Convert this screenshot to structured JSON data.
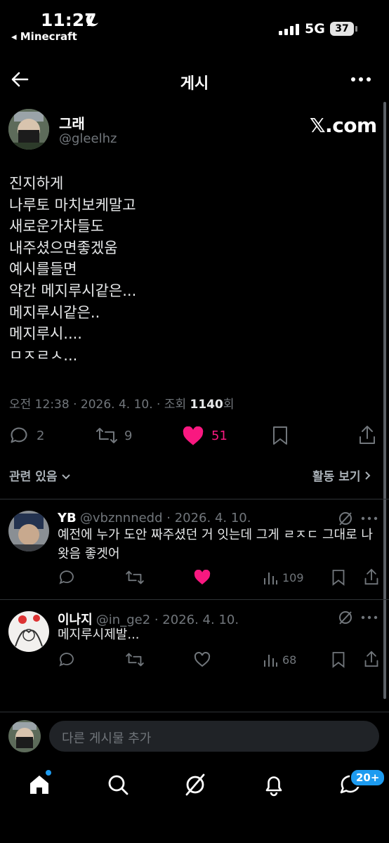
{
  "status_bar": {
    "time": "11:27",
    "back_app": "◂ Minecraft",
    "network": "5G",
    "battery": "37"
  },
  "header": {
    "title": "게시"
  },
  "post": {
    "author_name": "그래",
    "author_handle": "@gleelhz",
    "watermark": "𝕏.com",
    "lines": [
      "진지하게",
      "나루토 마치보케말고",
      "새로운가차들도",
      "내주셨으면좋겠움",
      "예시를들면",
      "약간 메지루시같은...",
      "메지루시같은..",
      "메지루시....",
      "ㅁㅈㄹㅅ..."
    ],
    "meta_prefix": "오전 12:38 · 2026. 4. 10. · 조회 ",
    "views": "1140",
    "meta_suffix": "회",
    "actions": {
      "replies": "2",
      "reposts": "9",
      "likes": "51"
    }
  },
  "related": {
    "left_label": "관련 있음",
    "right_label": "활동 보기"
  },
  "replies": [
    {
      "name": "YB",
      "meta": "@vbznnnedd · 2026. 4. 10.",
      "text": "예전에 누가 도안 짜주셨던 거 잇는데 그게 ㄹㅈㄷ 그대로 나\n왓음 좋겟어",
      "views": "109",
      "liked": true
    },
    {
      "name": "이나지",
      "meta": "@in_ge2 · 2026. 4. 10.",
      "text": "메지루시제발...",
      "views": "68",
      "liked": false
    }
  ],
  "compose": {
    "placeholder": "다른 게시물 추가"
  },
  "nav": {
    "badge": "20+"
  },
  "colors": {
    "like": "#f91880",
    "accent": "#1d9bf0",
    "muted": "#71767b"
  }
}
